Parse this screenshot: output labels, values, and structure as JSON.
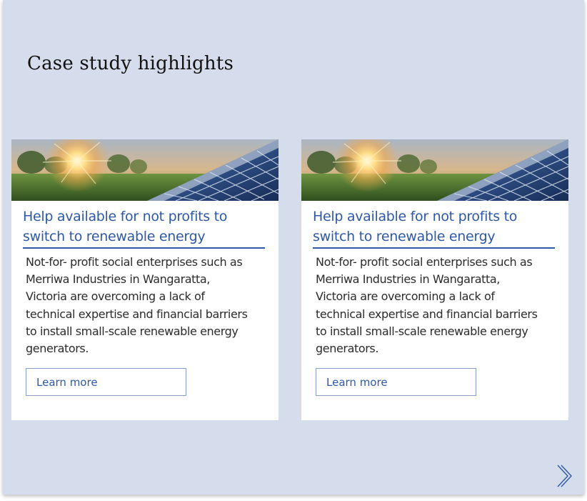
{
  "section": {
    "title": "Case study highlights"
  },
  "cards": [
    {
      "image_alt": "solar-panels-at-sunset",
      "title": "Help available for not profits to switch to renewable energy",
      "body": "Not-for- profit social enterprises such as Merriwa Industries in Wangaratta, Victoria are overcoming a lack of technical expertise and financial barriers to install small-scale renewable energy generators.",
      "cta_label": "Learn more"
    },
    {
      "image_alt": "solar-panels-at-sunset",
      "title": "Help available for not profits to switch to renewable energy",
      "body": "Not-for- profit social enterprises such as Merriwa Industries in Wangaratta, Victoria are overcoming a lack of technical expertise and financial barriers to install small-scale renewable energy generators.",
      "cta_label": "Learn more"
    }
  ],
  "navigation": {
    "next_icon": "double-chevron-right-icon"
  },
  "colors": {
    "background": "#d5dceb",
    "card": "#ffffff",
    "accent": "#2e58a8",
    "button_border": "#8aa0cb",
    "text": "#2b2b2b"
  }
}
